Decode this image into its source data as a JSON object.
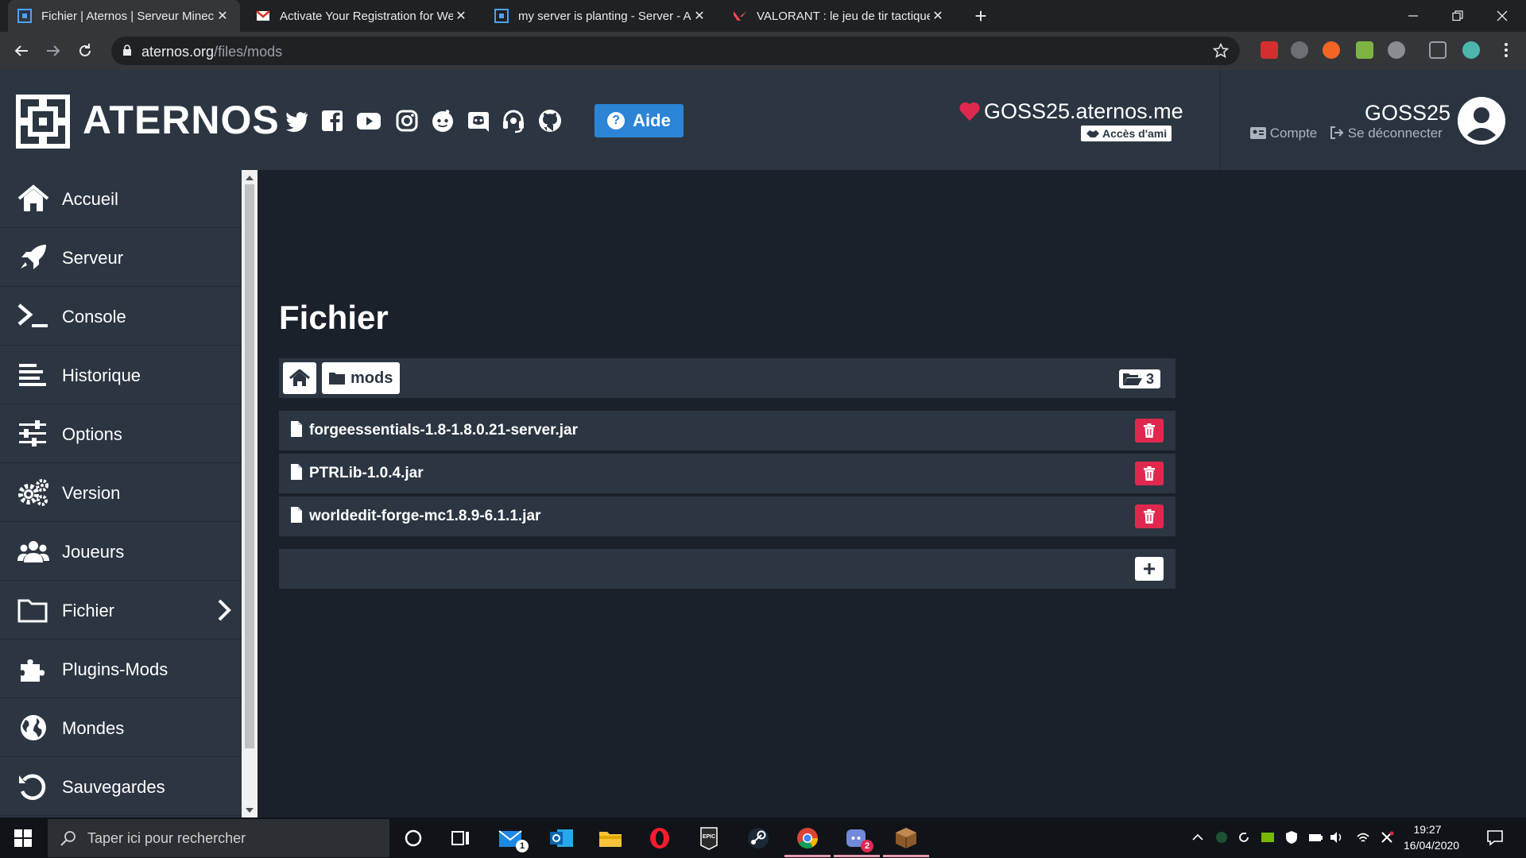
{
  "browser": {
    "tabs": [
      {
        "title": "Fichier | Aternos | Serveur Minecr",
        "active": true,
        "favicon": "aternos-favicon"
      },
      {
        "title": "Activate Your Registration for We",
        "active": false,
        "favicon": "gmail-favicon"
      },
      {
        "title": "my server is planting - Server - A",
        "active": false,
        "favicon": "aternos-favicon"
      },
      {
        "title": "VALORANT : le jeu de tir tactique",
        "active": false,
        "favicon": "valorant-favicon"
      }
    ],
    "close_glyph": "✕",
    "new_tab_glyph": "+",
    "url_domain": "aternos.org",
    "url_path": "/files/mods"
  },
  "header": {
    "brand": "ATERNOS",
    "social_icons": [
      "twitter-icon",
      "facebook-icon",
      "youtube-icon",
      "instagram-icon",
      "reddit-icon",
      "discord-icon",
      "support-headset-icon",
      "github-icon"
    ],
    "help_label": "Aide",
    "help_glyph": "?",
    "server_address": "GOSS25.aternos.me",
    "friend_access_label": "Accès d'ami",
    "username": "GOSS25",
    "account_label": "Compte",
    "logout_label": "Se déconnecter"
  },
  "sidebar": {
    "items": [
      {
        "label": "Accueil",
        "icon": "home-icon"
      },
      {
        "label": "Serveur",
        "icon": "rocket-icon"
      },
      {
        "label": "Console",
        "icon": "terminal-icon"
      },
      {
        "label": "Historique",
        "icon": "history-lines-icon"
      },
      {
        "label": "Options",
        "icon": "sliders-icon"
      },
      {
        "label": "Version",
        "icon": "gears-icon"
      },
      {
        "label": "Joueurs",
        "icon": "users-icon"
      },
      {
        "label": "Fichier",
        "icon": "folder-icon",
        "active": true
      },
      {
        "label": "Plugins-Mods",
        "icon": "puzzle-icon"
      },
      {
        "label": "Mondes",
        "icon": "globe-icon"
      },
      {
        "label": "Sauvegardes",
        "icon": "undo-icon"
      }
    ]
  },
  "main": {
    "title": "Fichier",
    "breadcrumb_folder": "mods",
    "folder_count": "3",
    "files": [
      {
        "name": "forgeessentials-1.8-1.8.0.21-server.jar"
      },
      {
        "name": "PTRLib-1.0.4.jar"
      },
      {
        "name": "worldedit-forge-mc1.8.9-6.1.1.jar"
      }
    ],
    "add_glyph": "+"
  },
  "taskbar": {
    "search_placeholder": "Taper ici pour rechercher",
    "apps": [
      "cortana-icon",
      "task-view-icon",
      "mail-icon",
      "outlook-icon",
      "file-explorer-icon",
      "opera-icon",
      "epic-games-icon",
      "steam-icon",
      "chrome-icon",
      "discord-app-icon",
      "minecraft-icon"
    ],
    "mail_badge": "1",
    "discord_badge": "2",
    "time": "19:27",
    "date": "16/04/2020"
  },
  "colors": {
    "panel": "#2c3642",
    "background": "#1b212b",
    "accent_blue": "#2b84d6",
    "danger": "#e0284f",
    "heart": "#e0284f"
  }
}
